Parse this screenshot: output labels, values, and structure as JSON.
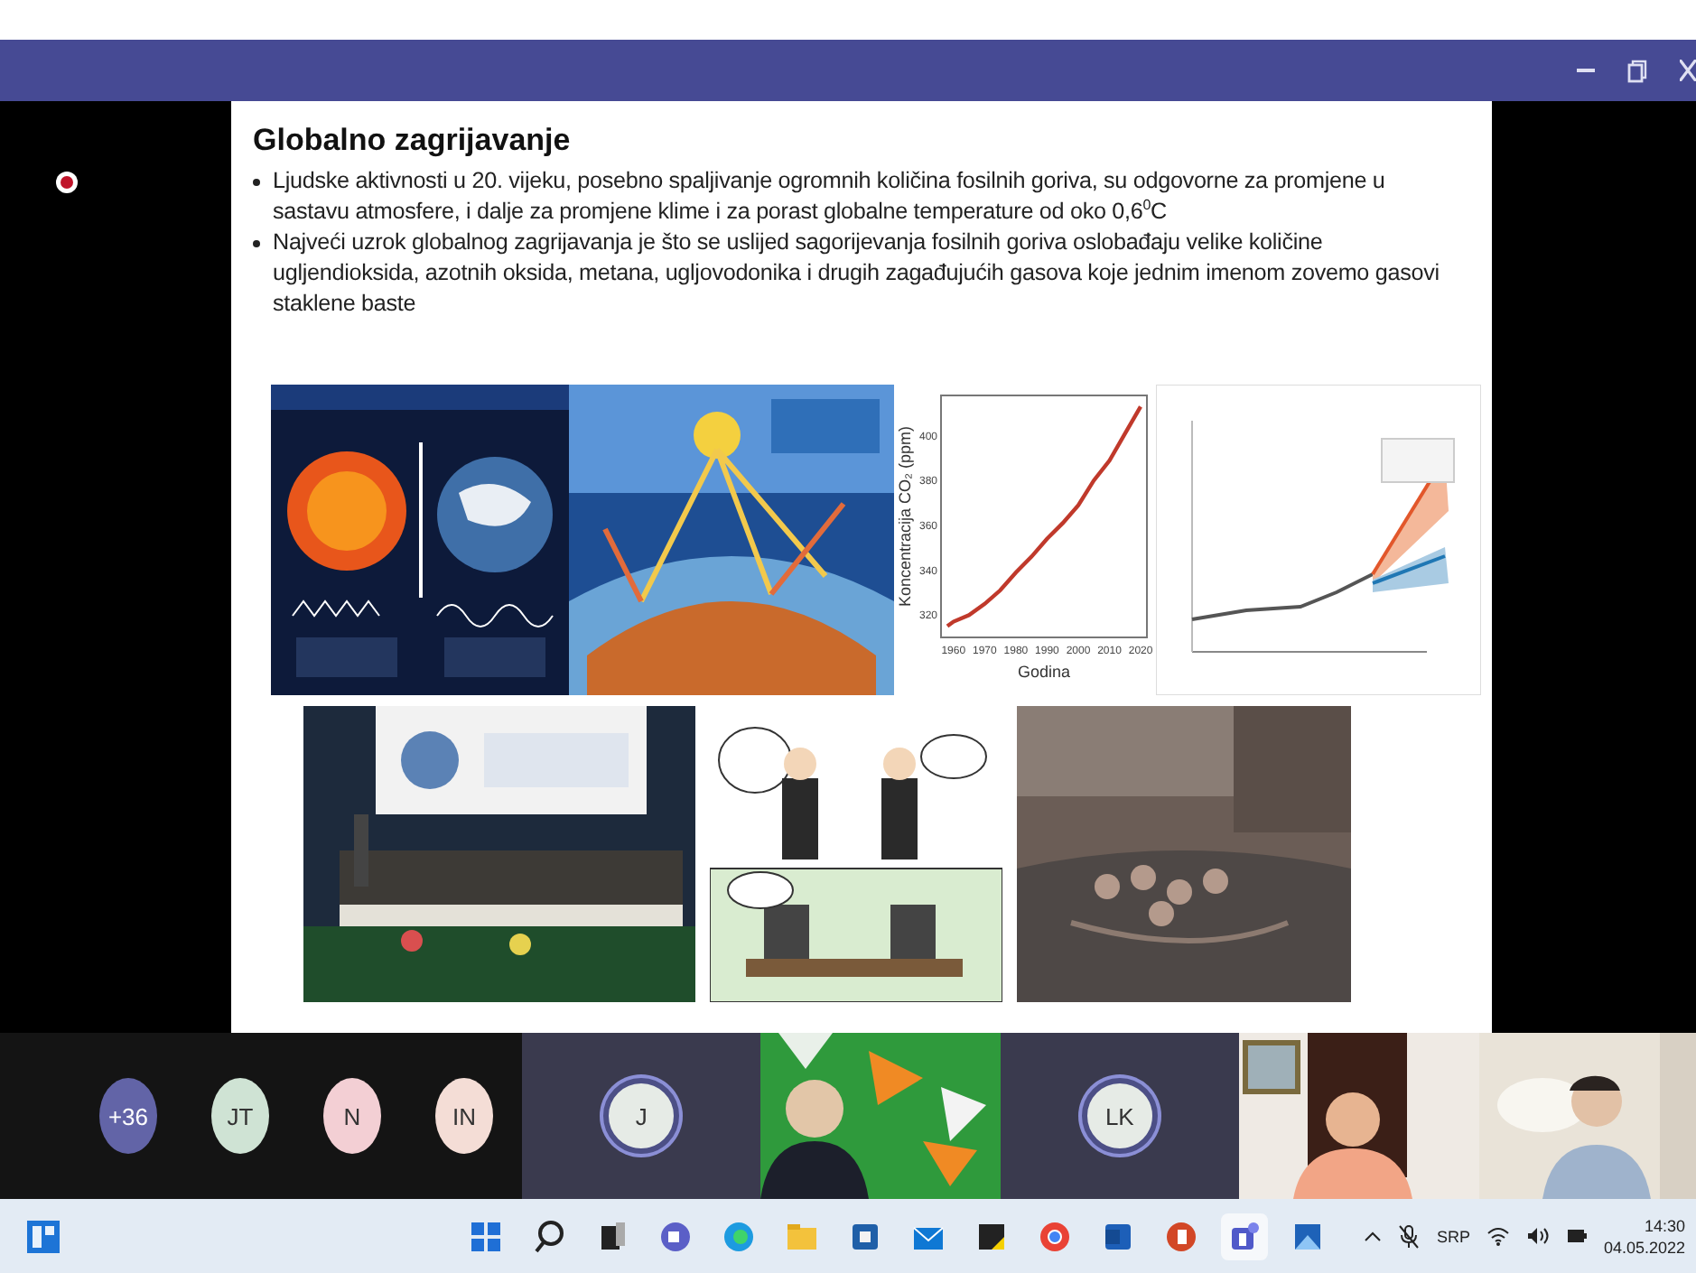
{
  "slide": {
    "title": "Globalno zagrijavanje",
    "bullets": [
      "Ljudske aktivnosti u 20. vijeku, posebno spaljivanje ogromnih količina fosilnih goriva, su odgovorne za promjene u sastavu atmosfere, i dalje za promjene klime i za porast globalne temperature od oko 0,6$^{0}$C",
      "Najveći uzrok globalnog zagrijavanja je što se uslijed sagorijevanja fosilnih goriva oslobađaju velike količine ugljendioksida, azotnih oksida, metana, ugljovodonika i drugih zagađujućih gasova koje jednim imenom zovemo gasovi staklene baste"
    ],
    "row_1": [
      {
        "kind": "picture"
      },
      {
        "kind": "picture"
      },
      {
        "kind": "chart"
      },
      {
        "kind": "picture"
      }
    ],
    "row_2": [
      {
        "kind": "picture"
      },
      {
        "kind": "picture"
      },
      {
        "kind": "picture"
      }
    ],
    "chart_data": {
      "type": "line",
      "xlabel": "Godina",
      "ylabel": "Koncentracija CO₂ (ppm)",
      "x": [
        1958,
        1960,
        1965,
        1970,
        1975,
        1980,
        1985,
        1990,
        1995,
        2000,
        2005,
        2010,
        2015,
        2020
      ],
      "series": [
        {
          "color": "#c0392b",
          "values": [
            315,
            317,
            320,
            325,
            331,
            339,
            346,
            354,
            361,
            369,
            380,
            389,
            401,
            413
          ]
        }
      ],
      "xlim": [
        1956,
        2022
      ],
      "ylim": [
        310,
        418
      ],
      "xticks": [
        1960,
        1970,
        1980,
        1990,
        2000,
        2010,
        2020
      ],
      "yticks": [
        320,
        340,
        360,
        380,
        400
      ]
    }
  },
  "participants": [
    {
      "kind": "avatar",
      "initials": "+36",
      "color": "#6264a7"
    },
    {
      "kind": "avatar",
      "initials": "JT",
      "color": "#cfe3d4"
    },
    {
      "kind": "avatar",
      "initials": "N",
      "color": "#f3cfd4"
    },
    {
      "kind": "avatar",
      "initials": "IN",
      "color": "#f4ddd6"
    },
    {
      "kind": "tile",
      "initials": "J"
    },
    {
      "kind": "video"
    },
    {
      "kind": "tile",
      "initials": "LK"
    },
    {
      "kind": "video"
    },
    {
      "kind": "video"
    }
  ],
  "taskbar": {
    "apps": [
      {
        "selected": false
      },
      {
        "selected": false
      },
      {
        "selected": false
      },
      {
        "selected": false
      },
      {
        "selected": false
      },
      {
        "selected": false
      },
      {
        "selected": false
      },
      {
        "selected": false
      },
      {
        "selected": false
      },
      {
        "selected": false
      },
      {
        "selected": false
      },
      {
        "selected": false
      },
      {
        "selected": true
      },
      {
        "selected": false
      }
    ],
    "language": "SRP",
    "time": "14:30",
    "date": "04.05.2022"
  }
}
